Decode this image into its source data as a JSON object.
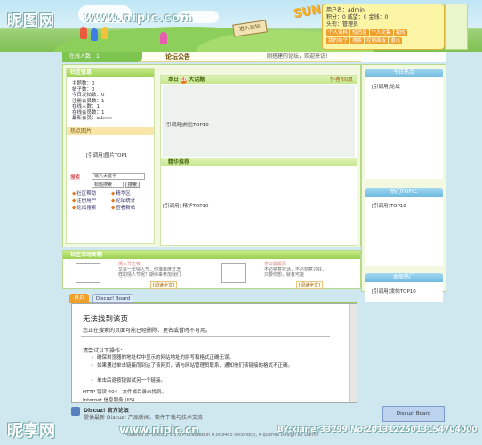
{
  "watermark": {
    "top_logo": "昵图网",
    "top_url": "www.nipic.com",
    "bottom_logo": "昵享网",
    "bottom_url": "www.nipic.cn",
    "bottom_id": "BY:xianer33299 No:20131225013154704000"
  },
  "header": {
    "sign_text": "进入论坛",
    "sun_text": "SUN",
    "user": {
      "line1": "用户名：admin",
      "line2": "积分：0  威望：0  金钱：0",
      "line3": "头衔：管理员",
      "links": [
        "个人资料",
        "短消息",
        "个人文集",
        "我的",
        "我的帖子",
        "搜索",
        "控制面板",
        "退出"
      ]
    }
  },
  "nav": {
    "online": "在线人数：1",
    "announce_label": "论坛公告",
    "announce_text": "刚搭建的论坛，欢迎来访!"
  },
  "left": {
    "title": "社区信息",
    "stats": [
      "主题数：0",
      "帖子数：0",
      "今日发帖数：0",
      "注册会员数：1",
      "在线人数：1",
      "在线会员数：1",
      "最新会员：admin"
    ],
    "hot_pic_title": "热点图片",
    "hot_pic_call": "[引调用]图片TOP1",
    "search_label": "搜索",
    "search_placeholder": "输入关键字",
    "select_value": "标题搜索",
    "search_button": "搜索",
    "quick_links": [
      "社区帮助",
      "精华区",
      "注册用户",
      "论坛统计",
      "论坛搜索",
      "查看新帖"
    ]
  },
  "center": {
    "hot_head": "本日",
    "hot_head_num": "10",
    "hot_head_tail": "大话题",
    "hot_more": "作者/回复",
    "hot_call": "[引调用]热贴TOP10",
    "digest_head": "精华推荐",
    "digest_call": "[引调用] 精华TOP10"
  },
  "right": {
    "box1_title": "今日热点",
    "box1_call": "[引调用]论坛",
    "box2_title": "热门TOPIC",
    "box2_call": "[引调用]TOP10",
    "box3_title": "本周热门",
    "box3_call": "[引调用]发帖TOP10"
  },
  "activity": {
    "title": "社区活动专题",
    "card1": {
      "title": "情人节之夜",
      "desc": "又是一年情人节，你准备度过怎样的情人节呢？期待来参加我们组织的party吧",
      "more": "[阅读全文]"
    },
    "card2": {
      "title": "冬日暖暖风",
      "desc": "不必特意找话，不必刻意讨好，只要你想，就有可能",
      "more": "[阅读全文]"
    }
  },
  "tabs": [
    "首页",
    "Discuz! Board"
  ],
  "error": {
    "title": "无法找到该页",
    "line1": "您正在搜索的页面可能已经删除、更名或暂时不可用。",
    "try_label": "请尝试以下操作：",
    "items": [
      "确保浏览器的地址栏中显示的网站地址的拼写和格式正确无误。",
      "如果通过单击链接而到达了该网页，请与网站管理员联系，通知他们该链接的格式不正确。",
      "单击后退按钮尝试另一个链接。"
    ],
    "code": "HTTP 错误 404 - 文件或目录未找到。",
    "ie": "Internet 信息服务 (IIS)"
  },
  "footer": {
    "line1": "Discuz! 官方论坛",
    "line2": "提供最新 Discuz! 产品新闻、软件下载与技术交流",
    "line3": "Powered by Discuz! 5.5.0  Processed in 0.009485 second(s), 4 queries  Design by Danny",
    "btn": "Discuz! Board"
  }
}
